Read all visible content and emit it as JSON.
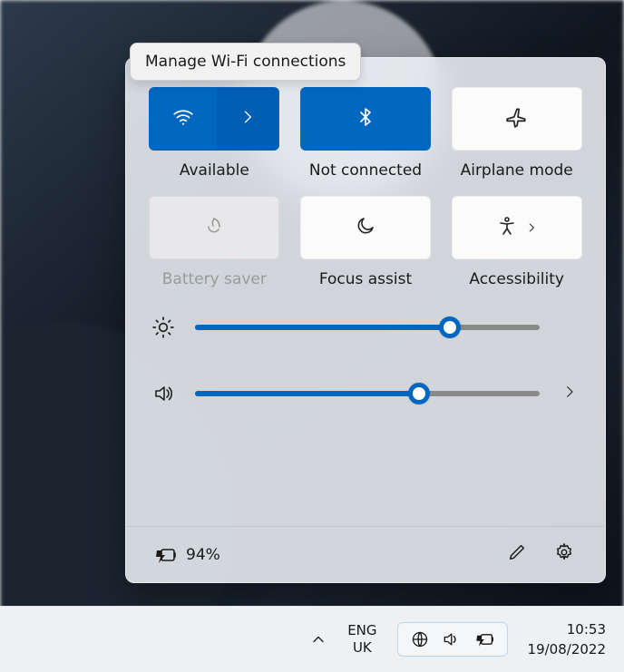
{
  "colors": {
    "accent": "#0067c0"
  },
  "tooltip": "Manage Wi-Fi connections",
  "tiles": {
    "wifi": {
      "label": "Available",
      "state": "on",
      "split": true
    },
    "bluetooth": {
      "label": "Not connected",
      "state": "on",
      "split": false
    },
    "airplane": {
      "label": "Airplane mode",
      "state": "off",
      "split": false
    },
    "battery_saver": {
      "label": "Battery saver",
      "state": "disabled",
      "split": false
    },
    "focus_assist": {
      "label": "Focus assist",
      "state": "off",
      "split": false
    },
    "accessibility": {
      "label": "Accessibility",
      "state": "off",
      "split": true
    }
  },
  "sliders": {
    "brightness": {
      "percent": 74
    },
    "volume": {
      "percent": 65
    }
  },
  "footer": {
    "battery_text": "94%"
  },
  "taskbar": {
    "lang_top": "ENG",
    "lang_bottom": "UK",
    "time": "10:53",
    "date": "19/08/2022"
  }
}
